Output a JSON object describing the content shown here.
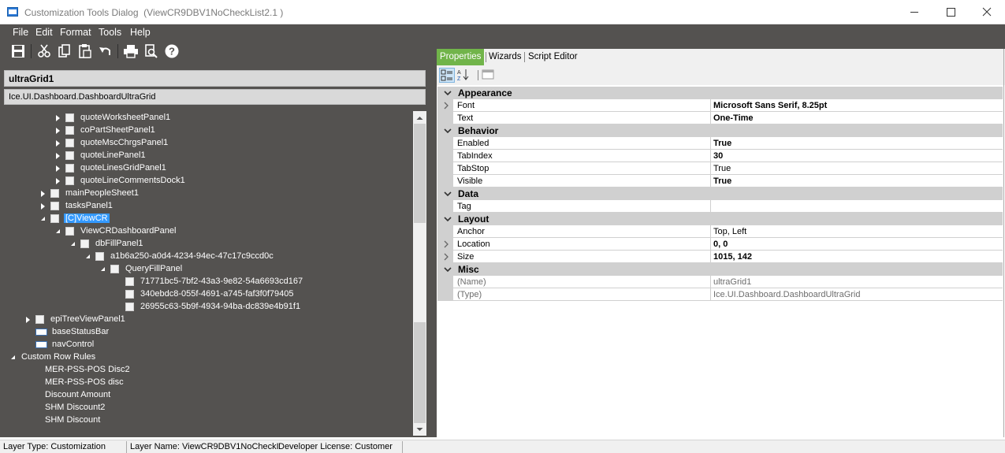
{
  "window": {
    "title": "Customization Tools Dialog  (ViewCR9DBV1NoCheckList2.1 )",
    "icon": "app-window-icon"
  },
  "menu": [
    "File",
    "Edit",
    "Format",
    "Tools",
    "Help"
  ],
  "toolbar": [
    "save-icon",
    "cut-icon",
    "copy-icon",
    "paste-icon",
    "undo-icon",
    "print-icon",
    "print-preview-icon",
    "help-icon"
  ],
  "left": {
    "control_name": "ultraGrid1",
    "control_type": "Ice.UI.Dashboard.DashboardUltraGrid"
  },
  "tree": [
    {
      "label": "quoteWorksheetPanel1",
      "level": 3,
      "expander": "collapsed",
      "icon": "box"
    },
    {
      "label": "coPartSheetPanel1",
      "level": 3,
      "expander": "collapsed",
      "icon": "box"
    },
    {
      "label": "quoteMscChrgsPanel1",
      "level": 3,
      "expander": "collapsed",
      "icon": "box"
    },
    {
      "label": "quoteLinePanel1",
      "level": 3,
      "expander": "collapsed",
      "icon": "box"
    },
    {
      "label": "quoteLinesGridPanel1",
      "level": 3,
      "expander": "collapsed",
      "icon": "box"
    },
    {
      "label": "quoteLineCommentsDock1",
      "level": 3,
      "expander": "collapsed",
      "icon": "box"
    },
    {
      "label": "mainPeopleSheet1",
      "level": 2,
      "expander": "collapsed",
      "icon": "box"
    },
    {
      "label": "tasksPanel1",
      "level": 2,
      "expander": "collapsed",
      "icon": "box"
    },
    {
      "label": "[C]ViewCR",
      "level": 2,
      "expander": "expanded",
      "icon": "box",
      "selected": true
    },
    {
      "label": "ViewCRDashboardPanel",
      "level": 3,
      "expander": "expanded",
      "icon": "box"
    },
    {
      "label": "dbFillPanel1",
      "level": 4,
      "expander": "expanded",
      "icon": "box"
    },
    {
      "label": "a1b6a250-a0d4-4234-94ec-47c17c9ccd0c",
      "level": 5,
      "expander": "expanded",
      "icon": "box"
    },
    {
      "label": "QueryFillPanel",
      "level": 6,
      "expander": "expanded",
      "icon": "box"
    },
    {
      "label": "71771bc5-7bf2-43a3-9e82-54a6693cd167",
      "level": 7,
      "expander": "none",
      "icon": "box"
    },
    {
      "label": "340ebdc8-055f-4691-a745-faf3f0f79405",
      "level": 7,
      "expander": "none",
      "icon": "box"
    },
    {
      "label": "26955c63-5b9f-4934-94ba-dc839e4b91f1",
      "level": 7,
      "expander": "none",
      "icon": "box"
    },
    {
      "label": "epiTreeViewPanel1",
      "level": 1,
      "expander": "collapsed",
      "icon": "box"
    },
    {
      "label": "baseStatusBar",
      "level": 1,
      "expander": "none",
      "icon": "statusbar"
    },
    {
      "label": "navControl",
      "level": 1,
      "expander": "none",
      "icon": "nav"
    },
    {
      "label": "Custom Row Rules",
      "level": 0,
      "expander": "expanded",
      "icon": "none"
    },
    {
      "label": "MER-PSS-POS Disc2",
      "level": 1,
      "expander": "none",
      "icon": "none"
    },
    {
      "label": "MER-PSS-POS disc",
      "level": 1,
      "expander": "none",
      "icon": "none"
    },
    {
      "label": "Discount Amount",
      "level": 1,
      "expander": "none",
      "icon": "none"
    },
    {
      "label": "SHM Discount2",
      "level": 1,
      "expander": "none",
      "icon": "none"
    },
    {
      "label": "SHM Discount",
      "level": 1,
      "expander": "none",
      "icon": "none"
    }
  ],
  "tabs": [
    "Properties",
    "Wizards",
    "Script Editor"
  ],
  "active_tab": "Properties",
  "properties": [
    {
      "category": "Appearance",
      "items": [
        {
          "name": "Font",
          "value": "Microsoft Sans Serif, 8.25pt",
          "bold": true,
          "expandable": true
        },
        {
          "name": "Text",
          "value": "One-Time",
          "bold": true
        }
      ]
    },
    {
      "category": "Behavior",
      "items": [
        {
          "name": "Enabled",
          "value": "True",
          "bold": true
        },
        {
          "name": "TabIndex",
          "value": "30",
          "bold": true
        },
        {
          "name": "TabStop",
          "value": "True",
          "bold": false
        },
        {
          "name": "Visible",
          "value": "True",
          "bold": true
        }
      ]
    },
    {
      "category": "Data",
      "items": [
        {
          "name": "Tag",
          "value": "",
          "bold": false
        }
      ]
    },
    {
      "category": "Layout",
      "items": [
        {
          "name": "Anchor",
          "value": "Top, Left",
          "bold": false
        },
        {
          "name": "Location",
          "value": "0, 0",
          "bold": true,
          "expandable": true
        },
        {
          "name": "Size",
          "value": "1015, 142",
          "bold": true,
          "expandable": true
        }
      ]
    },
    {
      "category": "Misc",
      "items": [
        {
          "name": "(Name)",
          "value": "ultraGrid1",
          "bold": false,
          "muted": true
        },
        {
          "name": "(Type)",
          "value": "Ice.UI.Dashboard.DashboardUltraGrid",
          "bold": false,
          "muted": true
        }
      ]
    }
  ],
  "status": {
    "layer_type": "Layer Type:  Customization",
    "layer_name": "Layer Name:  ViewCR9DBV1NoCheckI",
    "license": "Developer License:  Customer"
  },
  "colors": {
    "dark_bg": "#545250",
    "tab_active": "#71b44a",
    "selection": "#3399ff",
    "category_bg": "#d0d0d0"
  }
}
